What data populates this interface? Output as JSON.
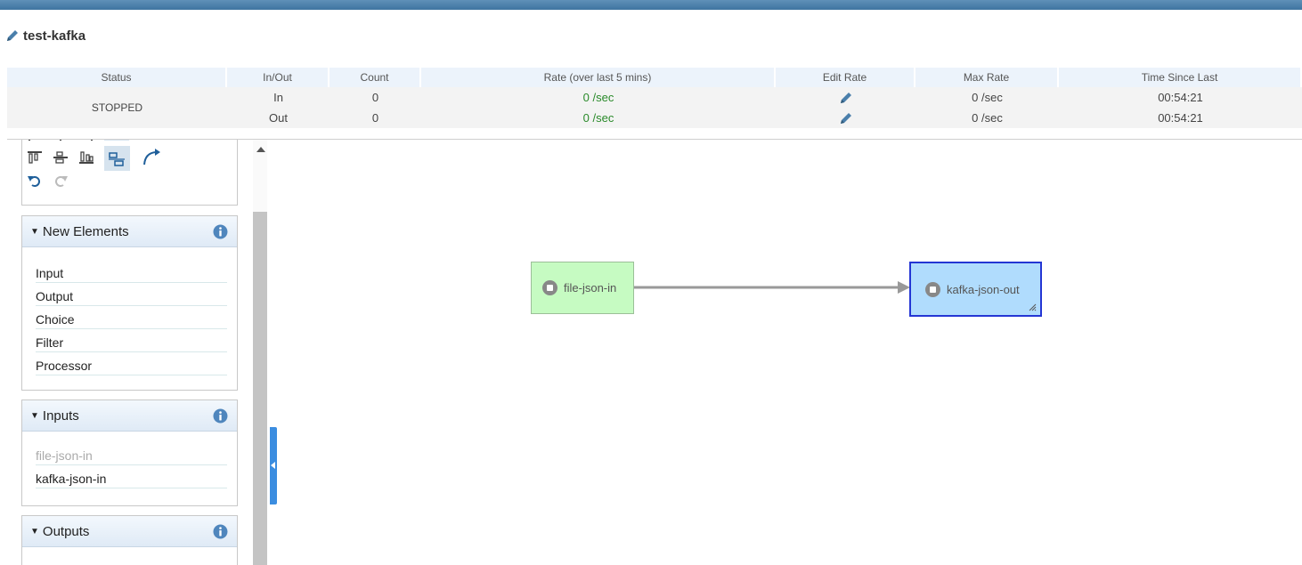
{
  "header": {
    "title": "test-kafka",
    "edit_icon": "pencil-icon",
    "accent_color": "#4a7fab"
  },
  "stats": {
    "columns": [
      "Status",
      "In/Out",
      "Count",
      "Rate (over last 5 mins)",
      "Edit Rate",
      "Max Rate",
      "Time Since Last"
    ],
    "status": "STOPPED",
    "rows": [
      {
        "direction": "In",
        "count": "0",
        "rate": "0 /sec",
        "max_rate": "0 /sec",
        "time_since_last": "00:54:21"
      },
      {
        "direction": "Out",
        "count": "0",
        "rate": "0 /sec",
        "max_rate": "0 /sec",
        "time_since_last": "00:54:21"
      }
    ]
  },
  "toolbox": {
    "icons": [
      "align-left-icon",
      "align-center-icon",
      "align-right-icon",
      "distribute-icon",
      "arrow-icon",
      "align-top-icon",
      "align-middle-icon",
      "align-bottom-icon",
      "auto-layout-icon",
      "curve-connector-icon",
      "undo-icon",
      "redo-icon"
    ]
  },
  "sections": {
    "new_elements": {
      "title": "New Elements",
      "items": [
        "Input",
        "Output",
        "Choice",
        "Filter",
        "Processor"
      ]
    },
    "inputs": {
      "title": "Inputs",
      "items": [
        "file-json-in",
        "kafka-json-in"
      ]
    },
    "outputs": {
      "title": "Outputs"
    }
  },
  "canvas": {
    "nodes": [
      {
        "label": "file-json-in",
        "type": "input",
        "color": "#c6fbc2"
      },
      {
        "label": "kafka-json-out",
        "type": "output",
        "color": "#b0dcfd",
        "selected": true
      }
    ]
  }
}
